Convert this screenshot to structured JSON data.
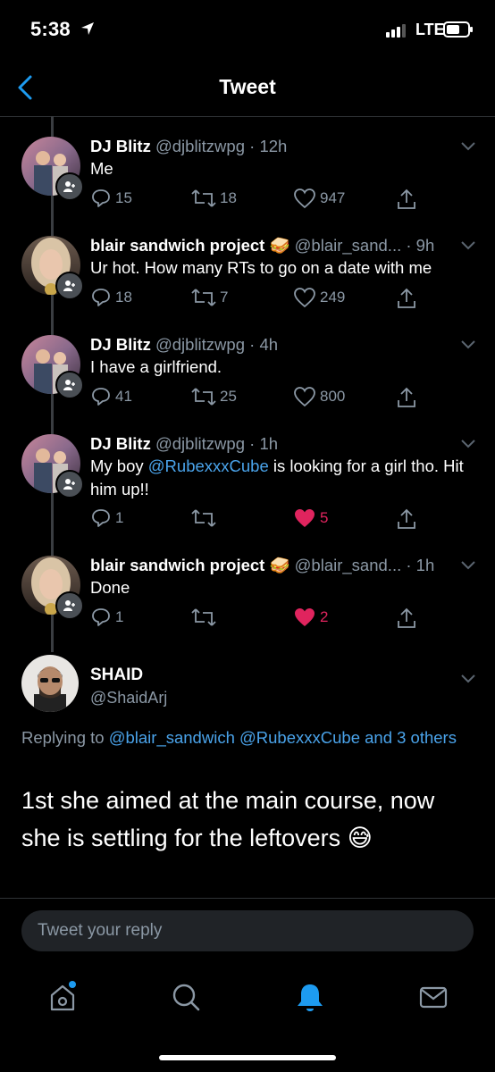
{
  "status": {
    "time": "5:38",
    "network": "LTE"
  },
  "nav": {
    "title": "Tweet"
  },
  "colors": {
    "accent": "#1d9bf0",
    "like": "#e0245e",
    "muted": "#8b98a5",
    "link": "#4aa3ea"
  },
  "thread": [
    {
      "name": "DJ Blitz",
      "meta": "@djblitzwpg · 12h",
      "text": "Me",
      "reply_count": "15",
      "retweet_count": "18",
      "like_count": "947",
      "liked": false
    },
    {
      "name": "blair sandwich project",
      "emoji": "🥪",
      "meta": "@blair_sand... · 9h",
      "text": "Ur hot. How many RTs to go on a date with me",
      "reply_count": "18",
      "retweet_count": "7",
      "like_count": "249",
      "liked": false
    },
    {
      "name": "DJ Blitz",
      "meta": "@djblitzwpg · 4h",
      "text": "I have a girlfriend.",
      "reply_count": "41",
      "retweet_count": "25",
      "like_count": "800",
      "liked": false
    },
    {
      "name": "DJ Blitz",
      "meta": "@djblitzwpg · 1h",
      "text_before": "My boy ",
      "mention": "@RubexxxCube",
      "text_after": " is looking for a girl tho. Hit him up!!",
      "reply_count": "1",
      "retweet_count": "",
      "like_count": "5",
      "liked": true
    },
    {
      "name": "blair sandwich project",
      "emoji": "🥪",
      "meta": "@blair_sand... · 1h",
      "text": "Done",
      "reply_count": "1",
      "retweet_count": "",
      "like_count": "2",
      "liked": true
    }
  ],
  "main": {
    "name": "SHAID",
    "handle": "@ShaidArj",
    "replying_prefix": "Replying to ",
    "replying_mentions": "@blair_sandwich @RubexxxCube and 3 others",
    "text": "1st she aimed at the main course, now she is settling for the leftovers",
    "emoji": "😅"
  },
  "reply": {
    "placeholder": "Tweet your reply"
  },
  "tabs": [
    {
      "icon": "home-icon"
    },
    {
      "icon": "search-icon"
    },
    {
      "icon": "notifications-bell-icon"
    },
    {
      "icon": "messages-envelope-icon"
    }
  ]
}
